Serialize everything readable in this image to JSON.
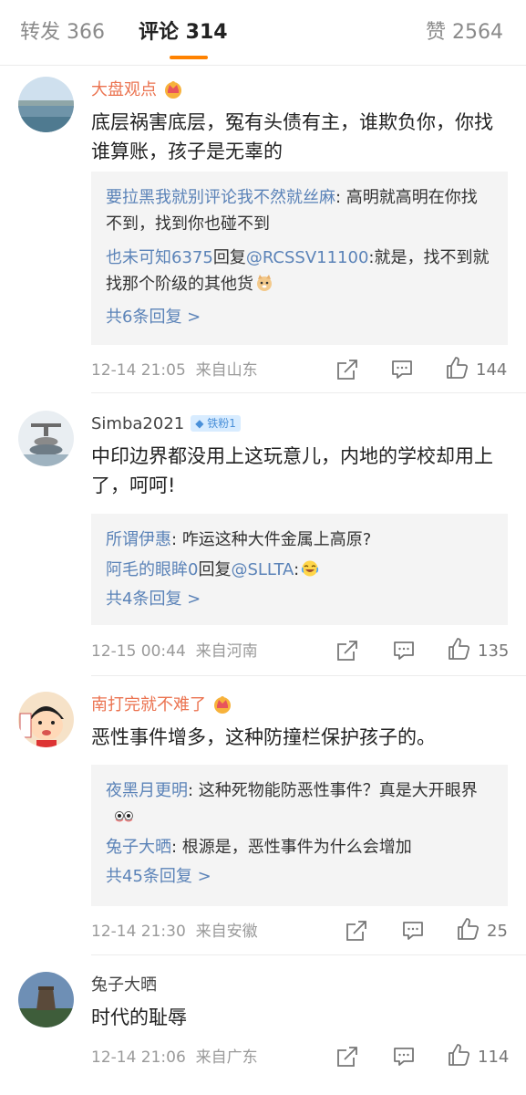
{
  "tabs": [
    {
      "label": "转发 366"
    },
    {
      "label": "评论 314"
    },
    {
      "label": "赞 2564"
    }
  ],
  "colors": {
    "accent": "#ff8200",
    "link": "#5b83b8",
    "vip_name": "#eb7350"
  },
  "comments": [
    {
      "author": "大盘观点",
      "badge_icon": "crown-badge-icon",
      "text": "底层祸害底层，冤有头债有主，谁欺负你，你找谁算账，孩子是无辜的",
      "replies": [
        {
          "user": "要拉黑我就别评论我不然就丝麻",
          "sep": ": ",
          "content": "高明就高明在你找不到，找到你也碰不到"
        },
        {
          "user": "也未可知6375",
          "mid": "回复",
          "at": "@RCSSV11100",
          "sep": ":",
          "content": "就是，找不到就找那个阶级的其他货",
          "emoji": "doge-emoji-icon"
        }
      ],
      "more": "共6条回复 >",
      "time": "12-14 21:05",
      "location": "来自山东",
      "likes": "144"
    },
    {
      "author": "Simba2021",
      "badge": "铁粉1",
      "text": "中印边界都没用上这玩意儿，内地的学校却用上了，呵呵!",
      "replies": [
        {
          "user": "所谓伊惠",
          "sep": ": ",
          "content": "咋运这种大件金属上高原?"
        },
        {
          "user": "阿毛的眼眸0",
          "mid": "回复",
          "at": "@SLLTA",
          "sep": ":",
          "content": "",
          "emoji": "laugh-cry-emoji-icon"
        }
      ],
      "more": "共4条回复 >",
      "time": "12-15 00:44",
      "location": "来自河南",
      "likes": "135"
    },
    {
      "author": "南打完就不难了",
      "badge_icon": "crown-badge-icon",
      "text": "恶性事件增多，这种防撞栏保护孩子的。",
      "replies": [
        {
          "user": "夜黑月更明",
          "sep": ": ",
          "content": "这种死物能防恶性事件？真是大开眼界",
          "emoji": "shocked-eyes-emoji-icon"
        },
        {
          "user": "兔子大晒",
          "sep": ": ",
          "content": "根源是，恶性事件为什么会增加"
        }
      ],
      "more": "共45条回复 >",
      "time": "12-14 21:30",
      "location": "来自安徽",
      "likes": "25"
    },
    {
      "author": "兔子大晒",
      "text": "时代的耻辱",
      "time": "12-14 21:06",
      "location": "来自广东",
      "likes": "114"
    }
  ]
}
